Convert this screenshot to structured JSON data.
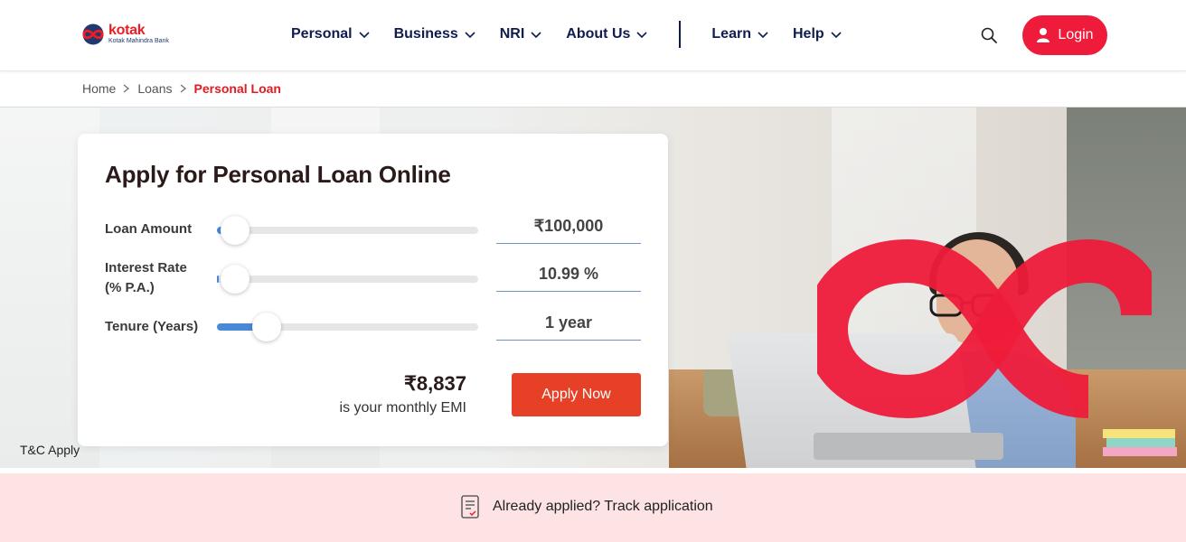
{
  "header": {
    "logo": {
      "brand": "kotak",
      "sub": "Kotak Mahindra Bank"
    },
    "nav": [
      {
        "label": "Personal"
      },
      {
        "label": "Business"
      },
      {
        "label": "NRI"
      },
      {
        "label": "About Us"
      },
      {
        "label": "Learn"
      },
      {
        "label": "Help"
      }
    ],
    "login_label": "Login",
    "brand_color": "#ee1b3a"
  },
  "breadcrumb": {
    "items": [
      "Home",
      "Loans"
    ],
    "current": "Personal Loan"
  },
  "calculator": {
    "title": "Apply for Personal Loan Online",
    "loan_amount": {
      "label": "Loan Amount",
      "value": "₹100,000",
      "slider_fraction": 0.02
    },
    "interest_rate": {
      "label_line1": "Interest Rate",
      "label_line2": "(% P.A.)",
      "value": "10.99 %",
      "slider_fraction": 0.0
    },
    "tenure": {
      "label": "Tenure (Years)",
      "value": "1 year",
      "slider_fraction": 0.19
    },
    "emi_amount": "₹8,837",
    "emi_label": "is your monthly EMI",
    "apply_label": "Apply Now"
  },
  "hero": {
    "tnc": "T&C Apply"
  },
  "track": {
    "label": "Already applied? Track application"
  },
  "icons": {
    "search": "search-icon",
    "user": "user-icon",
    "chevron": "chevron-down-icon",
    "document": "document-check-icon"
  }
}
